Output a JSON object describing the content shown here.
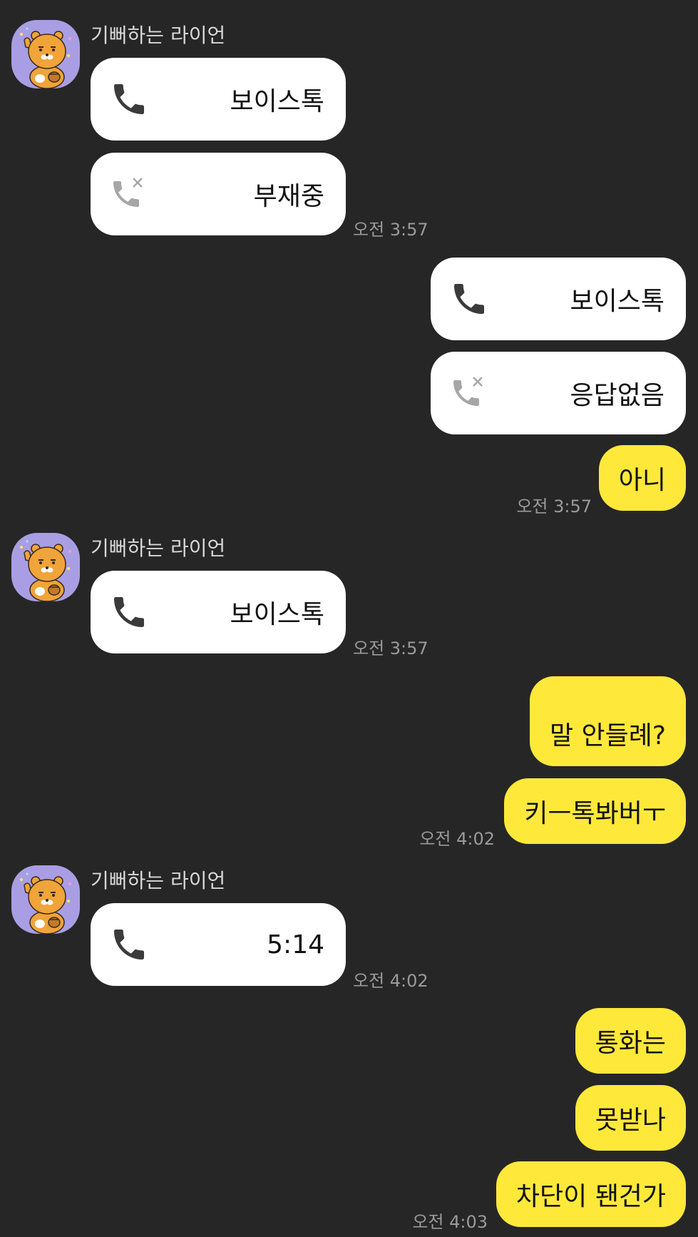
{
  "colors": {
    "background": "#262626",
    "incoming_bubble": "#ffffff",
    "outgoing_bubble": "#fee83a",
    "avatar_bg": "#a99ee3"
  },
  "sender": {
    "name": "기뻐하는 라이언",
    "avatar_icon": "ryan-character-icon"
  },
  "messages": {
    "m1": {
      "label": "보이스톡",
      "icon": "phone-icon"
    },
    "m2": {
      "label": "부재중",
      "icon": "missed-call-icon",
      "time": "오전 3:57"
    },
    "m3": {
      "label": "보이스톡",
      "icon": "phone-icon"
    },
    "m4": {
      "label": "응답없음",
      "icon": "missed-call-icon"
    },
    "m5": {
      "text": "아니",
      "time": "오전 3:57"
    },
    "m6": {
      "label": "보이스톡",
      "icon": "phone-icon",
      "time": "오전 3:57"
    },
    "m7": {
      "text": "말 안들례?"
    },
    "m8": {
      "text": "키ㅡ톡봐버ㅜ",
      "time": "오전 4:02"
    },
    "m9": {
      "label": "5:14",
      "icon": "phone-icon",
      "time": "오전 4:02"
    },
    "m10": {
      "text": "통화는"
    },
    "m11": {
      "text": "못받나"
    },
    "m12": {
      "text": "차단이 됀건가",
      "time": "오전 4:03"
    }
  }
}
